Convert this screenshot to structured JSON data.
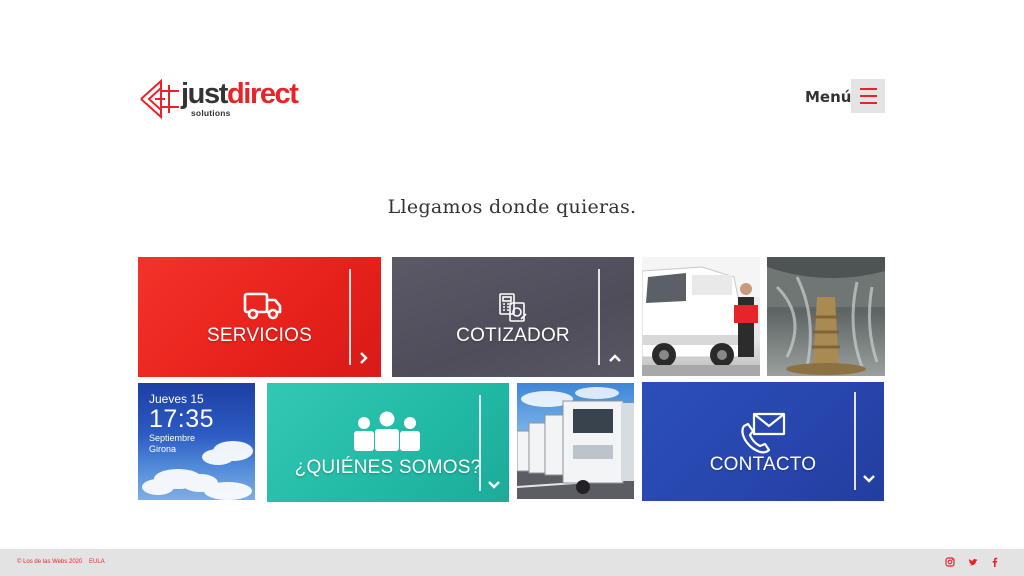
{
  "header": {
    "logo": {
      "brand_part1": "just",
      "brand_part2": "direct",
      "subtitle": "solutions"
    },
    "menu_label": "Menú"
  },
  "tagline": "Llegamos donde quieras.",
  "tiles": {
    "servicios": {
      "label": "SERVICIOS",
      "icon": "truck-icon",
      "arrow": "›"
    },
    "cotizador": {
      "label": "COTIZADOR",
      "icon": "calculator-document-icon",
      "arrow": "^"
    },
    "quienes": {
      "label": "¿QUIÉNES SOMOS?",
      "icon": "people-group-icon",
      "arrow": "⌄"
    },
    "contacto": {
      "label": "CONTACTO",
      "icon": "envelope-phone-icon",
      "arrow": "⌄"
    }
  },
  "weather": {
    "day": "Jueves 15",
    "time": "17:35",
    "month": "Septiembre",
    "city": "Girona"
  },
  "footer": {
    "copyright": "© Los de las Webs 2020",
    "eula": "EULA",
    "social": [
      "instagram-icon",
      "twitter-icon",
      "facebook-icon"
    ]
  },
  "colors": {
    "brand_red": "#e8232a",
    "servicios_bg": "#ec2a23",
    "cotizador_bg": "#55535f",
    "quienes_bg": "#24bba7",
    "contacto_bg": "#2848b0",
    "footer_bg": "#e3e3e3"
  }
}
